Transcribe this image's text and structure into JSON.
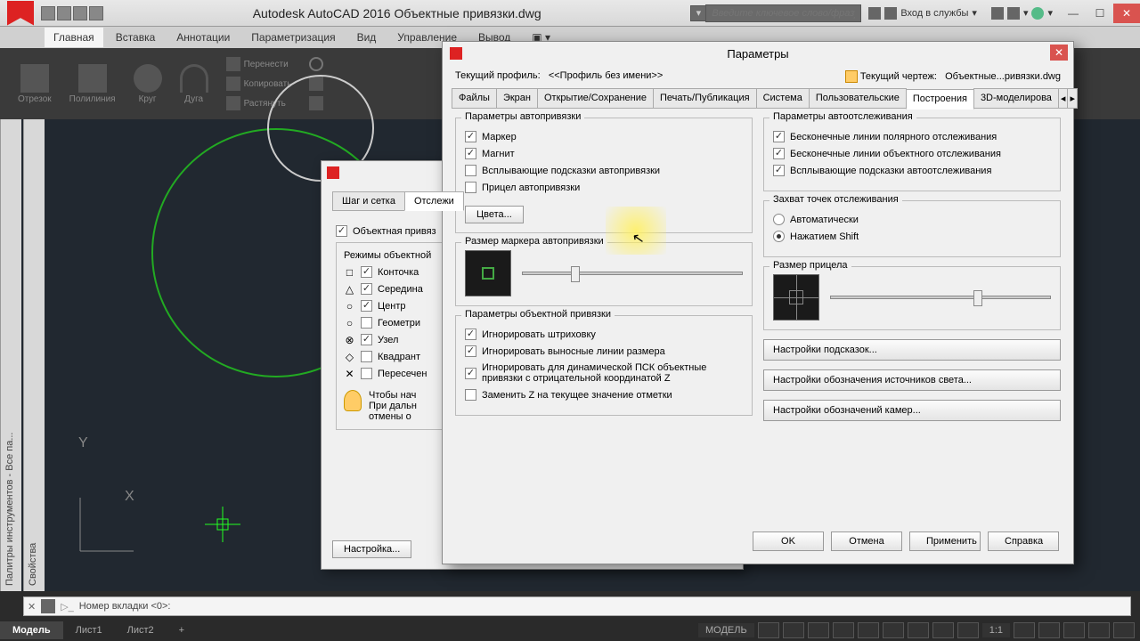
{
  "app": {
    "title": "Autodesk AutoCAD 2016    Объектные привязки.dwg",
    "search_placeholder": "Введите ключевое слово/фразу",
    "login": "Вход в службы"
  },
  "ribbon": {
    "tabs": [
      "Главная",
      "Вставка",
      "Аннотации",
      "Параметризация",
      "Вид",
      "Управление",
      "Вывод"
    ],
    "panel": {
      "arc": "Дуга",
      "line": "Отрезок",
      "pline": "Полилиния",
      "circle": "Круг",
      "move": "Перенести",
      "copy": "Копировать",
      "stretch": "Растянуть"
    }
  },
  "palettes": {
    "p1": "Палитры инструментов - Все па...",
    "p2": "Свойства"
  },
  "cmd": {
    "prompt": "Номер вкладки <0>:"
  },
  "modeltabs": {
    "model": "Модель",
    "sheet1": "Лист1",
    "sheet2": "Лист2",
    "add": "+",
    "status_model": "МОДЕЛЬ",
    "scale": "1:1"
  },
  "dlg_back": {
    "tabs": {
      "grid": "Шаг и сетка",
      "track": "Отслежи"
    },
    "osnap_on": "Объектная привяз",
    "modes_title": "Режимы объектной",
    "end": "Конточка",
    "mid": "Середина",
    "cen": "Центр",
    "geo": "Геометри",
    "node": "Узел",
    "qua": "Квадрант",
    "int": "Пересечен",
    "tip": "Чтобы нач\nПри дальн\nотмены о",
    "btn": "Настройка..."
  },
  "dlg_front": {
    "title": "Параметры",
    "profile_lbl": "Текущий профиль:",
    "profile_val": "<<Профиль без имени>>",
    "drawing_lbl": "Текущий чертеж:",
    "drawing_val": "Объектные...ривязки.dwg",
    "tabs": {
      "files": "Файлы",
      "display": "Экран",
      "open": "Открытие/Сохранение",
      "plot": "Печать/Публикация",
      "system": "Система",
      "user": "Пользовательские",
      "draft": "Построения",
      "3d": "3D-моделирова"
    },
    "autosnap_title": "Параметры автопривязки",
    "marker": "Маркер",
    "magnet": "Магнит",
    "tooltip": "Всплывающие подсказки автопривязки",
    "aperture": "Прицел автопривязки",
    "colors": "Цвета...",
    "marker_size": "Размер маркера автопривязки",
    "osnap_opts_title": "Параметры объектной привязки",
    "ignore_hatch": "Игнорировать штриховку",
    "ignore_ext": "Игнорировать выносные линии размера",
    "ignore_ducs": "Игнорировать для динамической ПСК объектные привязки с отрицательной координатой Z",
    "replace_z": "Заменить Z на текущее значение отметки",
    "autotrack_title": "Параметры автоотслеживания",
    "polar_vec": "Бесконечные линии полярного отслеживания",
    "obj_vec": "Бесконечные линии объектного отслеживания",
    "track_tip": "Всплывающие подсказки автоотслеживания",
    "acq_title": "Захват точек отслеживания",
    "acq_auto": "Автоматически",
    "acq_shift": "Нажатием Shift",
    "aperture_size": "Размер прицела",
    "btn_tooltip": "Настройки подсказок...",
    "btn_light": "Настройки обозначения источников света...",
    "btn_camera": "Настройки обозначений камер...",
    "ok": "OK",
    "cancel": "Отмена",
    "apply": "Применить",
    "help": "Справка"
  }
}
